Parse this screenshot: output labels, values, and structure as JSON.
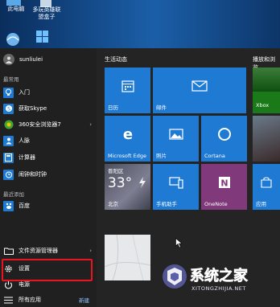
{
  "desktop": {
    "icons": [
      {
        "label": "此电脑"
      },
      {
        "label": "多玩英雄联\n盟盒子"
      }
    ]
  },
  "start_menu": {
    "user": {
      "name": "sunliulei"
    },
    "section_most_used": "最常用",
    "most_used": [
      {
        "label": "入门",
        "icon": "lightbulb-icon"
      },
      {
        "label": "获取Skype",
        "icon": "skype-icon"
      },
      {
        "label": "360安全浏览器7",
        "icon": "360-browser-icon"
      },
      {
        "label": "人脉",
        "icon": "people-icon"
      },
      {
        "label": "计算器",
        "icon": "calculator-icon"
      },
      {
        "label": "闹钟和时钟",
        "icon": "alarm-icon"
      }
    ],
    "section_recent": "最近添加",
    "recent": [
      {
        "label": "百度",
        "icon": "baidu-icon"
      }
    ],
    "bottom": {
      "file_explorer": "文件资源管理器",
      "settings": "设置",
      "power": "电源",
      "all_apps": "所有应用",
      "new_badge": "新建"
    },
    "groups": {
      "life": "生活动态",
      "entertainment": "播放和浏览"
    },
    "tiles": {
      "calendar": "日历",
      "mail": "邮件",
      "edge": "Microsoft Edge",
      "photos": "照片",
      "cortana": "Cortana",
      "weather_location": "晋阳区",
      "weather_temp": "33°",
      "weather_city": "北京",
      "phone": "手机助手",
      "onenote": "OneNote",
      "xbox": "Xbox",
      "store": "应用"
    }
  },
  "watermark": {
    "name": "系统之家",
    "url": "XITONGZHIJIA.NET"
  }
}
